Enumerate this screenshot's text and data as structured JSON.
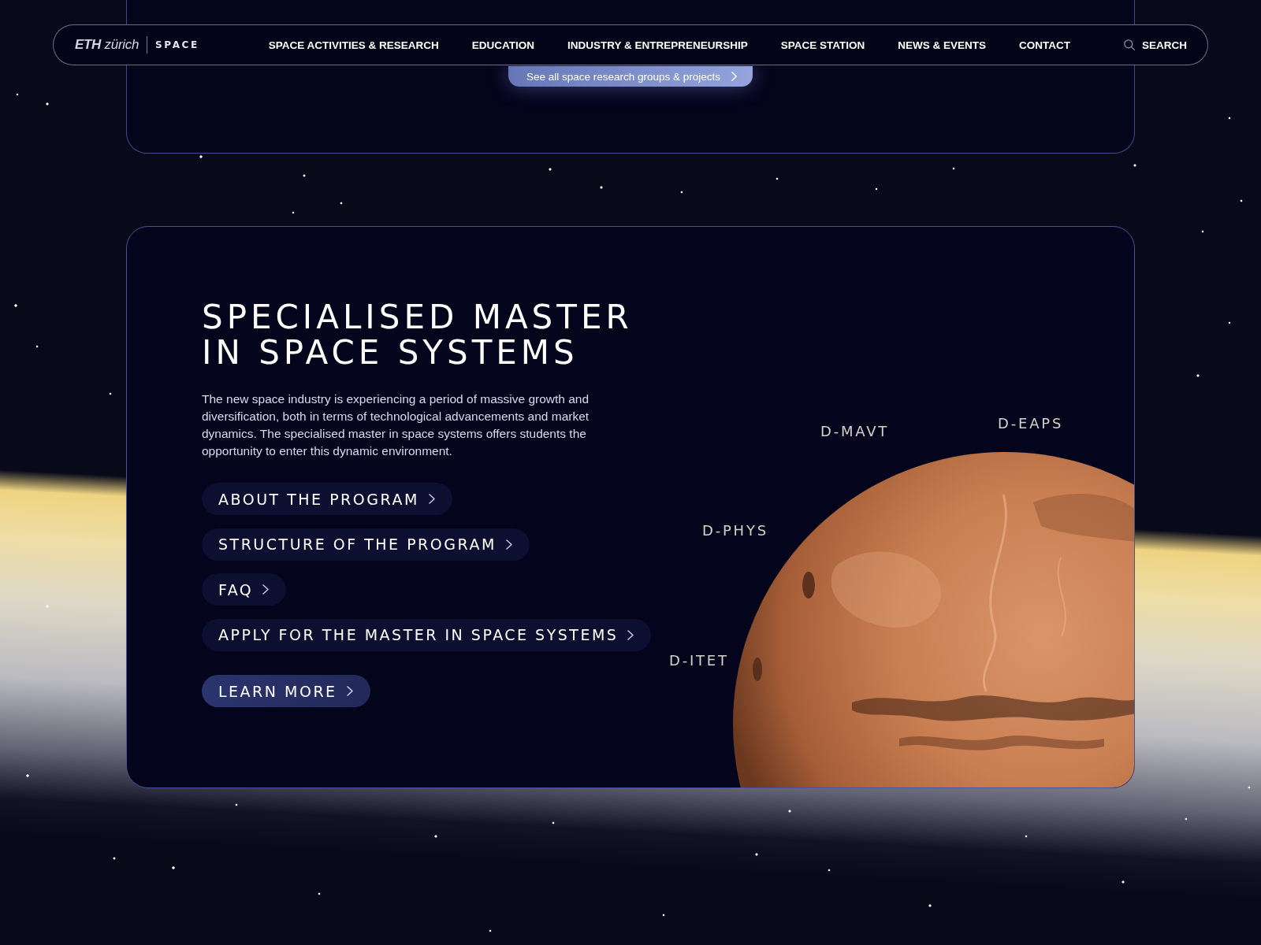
{
  "nav": {
    "logo": "**ETH** zürich",
    "brand": "SPACE",
    "links": [
      {
        "label": "SPACE ACTIVITIES & RESEARCH"
      },
      {
        "label": "EDUCATION"
      },
      {
        "label": "INDUSTRY & ENTREPRENEURSHIP"
      },
      {
        "label": "SPACE STATION"
      },
      {
        "label": "NEWS & EVENTS"
      },
      {
        "label": "CONTACT"
      }
    ],
    "search": "SEARCH"
  },
  "top_section": {
    "button": "See all space research groups & projects"
  },
  "program": {
    "title": "SPECIALISED MASTER IN SPACE SYSTEMS",
    "description": "The new space industry is experiencing a period of massive growth and diversification, both in terms of technological advancements and market dynamics. The specialised master in space systems offers students the opportunity to enter this dynamic environment.",
    "links": [
      {
        "label": "ABOUT THE PROGRAM"
      },
      {
        "label": "STRUCTURE OF THE PROGRAM"
      },
      {
        "label": "FAQ"
      },
      {
        "label": "APPLY FOR THE MASTER IN SPACE SYSTEMS"
      }
    ],
    "cta": "LEARN MORE"
  },
  "departments": [
    {
      "label": "D-MAVT"
    },
    {
      "label": "D-EAPS"
    },
    {
      "label": "D-PHYS"
    },
    {
      "label": "D-ITET"
    }
  ]
}
